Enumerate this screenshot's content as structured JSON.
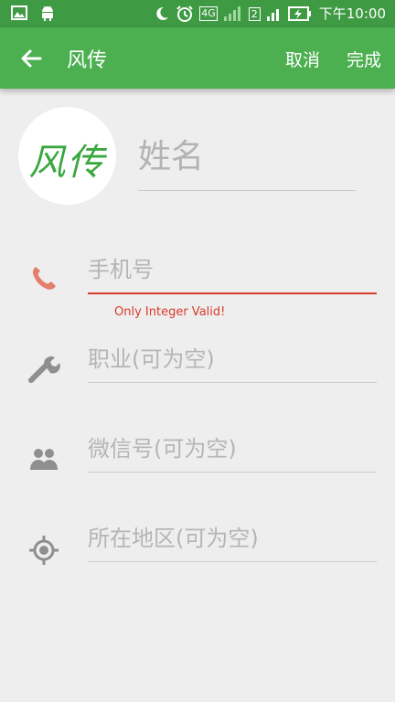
{
  "status_bar": {
    "time": "下午10:00",
    "network": "4G",
    "sim2_label": "2",
    "icons": [
      "gallery-icon",
      "android-icon",
      "moon-icon",
      "alarm-icon",
      "signal-icon",
      "battery-charging-icon"
    ]
  },
  "app_bar": {
    "title": "风传",
    "cancel_label": "取消",
    "done_label": "完成"
  },
  "avatar": {
    "text": "风传",
    "color": "#3aa83f"
  },
  "name_field": {
    "placeholder": "姓名"
  },
  "fields": [
    {
      "placeholder": "手机号",
      "icon": "phone-icon",
      "error": "Only Integer Valid!"
    },
    {
      "placeholder": "职业(可为空)",
      "icon": "wrench-icon"
    },
    {
      "placeholder": "微信号(可为空)",
      "icon": "people-icon"
    },
    {
      "placeholder": "所在地区(可为空)",
      "icon": "location-icon"
    }
  ],
  "colors": {
    "status_bar": "#3f9a44",
    "app_bar": "#4caf50",
    "error": "#d93a2b",
    "phone_icon": "#e57f6d",
    "muted_icon": "#8f8f8f"
  }
}
